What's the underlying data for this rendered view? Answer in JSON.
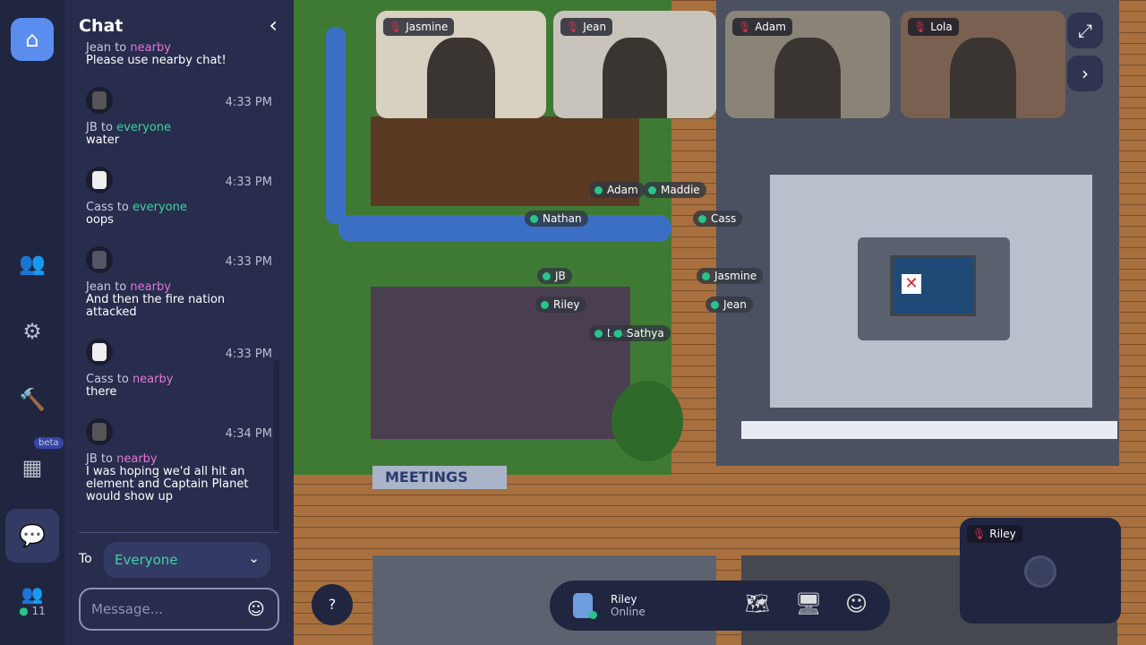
{
  "rail": {
    "items": [
      {
        "name": "home",
        "icon": "home-icon"
      },
      {
        "name": "people",
        "icon": "people-icon"
      },
      {
        "name": "settings",
        "icon": "gear-icon"
      },
      {
        "name": "build",
        "icon": "hammer-icon"
      },
      {
        "name": "calendar",
        "icon": "calendar-icon",
        "badge": "beta"
      },
      {
        "name": "chat",
        "icon": "chat-icon"
      },
      {
        "name": "participants",
        "icon": "participants-icon",
        "count": "11"
      }
    ],
    "accent": "#5b8def"
  },
  "chat": {
    "title": "Chat",
    "messages": [
      {
        "sender": "Jean",
        "to": "to",
        "audience": "nearby",
        "text": "Please use nearby chat!",
        "time": ""
      },
      {
        "sender": "JB",
        "to": "to",
        "audience": "everyone",
        "text": "water",
        "time": "4:33 PM"
      },
      {
        "sender": "Cass",
        "to": "to",
        "audience": "everyone",
        "text": "oops",
        "time": "4:33 PM"
      },
      {
        "sender": "Jean",
        "to": "to",
        "audience": "nearby",
        "text": "And then the fire nation attacked",
        "time": "4:33 PM"
      },
      {
        "sender": "Cass",
        "to": "to",
        "audience": "nearby",
        "text": "there",
        "time": "4:33 PM"
      },
      {
        "sender": "JB",
        "to": "to",
        "audience": "nearby",
        "text": "I was hoping we'd all hit an element and Captain Planet would show up",
        "time": "4:34 PM"
      }
    ],
    "to_label": "To",
    "recipient": "Everyone",
    "placeholder": "Message..."
  },
  "videos": [
    {
      "name": "Jasmine"
    },
    {
      "name": "Jean"
    },
    {
      "name": "Adam"
    },
    {
      "name": "Lola"
    }
  ],
  "map": {
    "sign": "MEETINGS",
    "labels": [
      "Adam",
      "Maddie",
      "Nathan",
      "Cass",
      "JB",
      "Jasmine",
      "Riley",
      "Jean",
      "Lola",
      "Sathya"
    ]
  },
  "help": "?",
  "bottom": {
    "name": "Riley",
    "status": "Online"
  },
  "self_video": {
    "name": "Riley"
  }
}
